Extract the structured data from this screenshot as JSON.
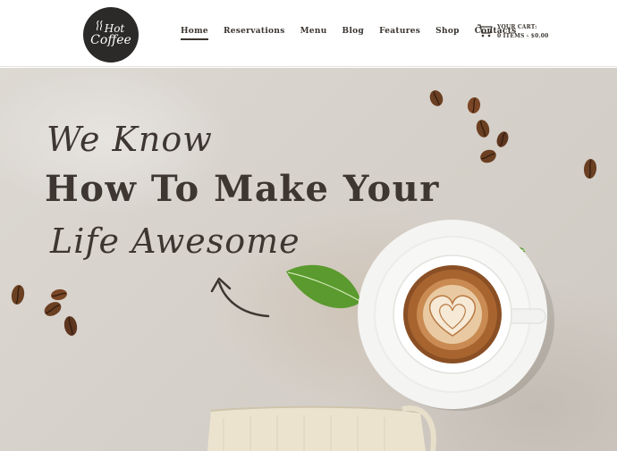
{
  "brand": {
    "logo_line1": "Hot",
    "logo_line2": "Coffee"
  },
  "nav": {
    "items": [
      {
        "label": "Home",
        "active": true
      },
      {
        "label": "Reservations",
        "active": false
      },
      {
        "label": "Menu",
        "active": false
      },
      {
        "label": "Blog",
        "active": false
      },
      {
        "label": "Features",
        "active": false
      },
      {
        "label": "Shop",
        "active": false
      },
      {
        "label": "Contacts",
        "active": false
      }
    ]
  },
  "cart": {
    "title": "YOUR CART:",
    "summary": "0 ITEMS - $0.00",
    "icon": "cart-icon"
  },
  "hero": {
    "line1": "We Know",
    "line2": "How To Make Your",
    "line3": "Life Awesome"
  },
  "colors": {
    "text_dark": "#3d3631",
    "logo_bg": "#2b2a28",
    "leaf": "#5a9a2e",
    "coffee_bean": "#6b3f22"
  }
}
